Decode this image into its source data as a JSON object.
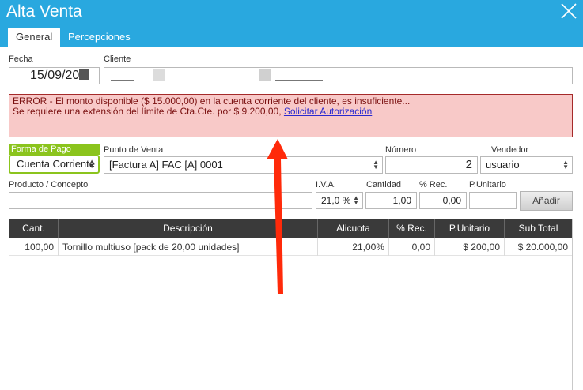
{
  "window": {
    "title": "Alta Venta"
  },
  "tabs": [
    {
      "label": "General",
      "active": true
    },
    {
      "label": "Percepciones",
      "active": false
    }
  ],
  "fecha": {
    "label": "Fecha",
    "value": "15/09/20"
  },
  "cliente": {
    "label": "Cliente"
  },
  "error": {
    "line1": "ERROR - El monto disponible ($ 15.000,00) en la cuenta corriente del cliente, es insuficiente...",
    "line2": "Se requiere una extensión del límite de Cta.Cte. por $ 9.200,00,",
    "link": "Solicitar Autorización"
  },
  "forma_pago": {
    "label": "Forma de Pago",
    "value": "Cuenta Corriente"
  },
  "punto_venta": {
    "label": "Punto de Venta",
    "value": "[Factura A] FAC [A] 0001"
  },
  "numero": {
    "label": "Número",
    "value": "2"
  },
  "vendedor": {
    "label": "Vendedor",
    "value": "usuario"
  },
  "producto": {
    "label": "Producto / Concepto",
    "value": ""
  },
  "iva": {
    "label": "I.V.A.",
    "value": "21,0 %"
  },
  "cantidad": {
    "label": "Cantidad",
    "value": "1,00"
  },
  "rec": {
    "label": "% Rec.",
    "value": "0,00"
  },
  "punitario": {
    "label": "P.Unitario",
    "value": ""
  },
  "add_button": "Añadir",
  "table": {
    "headers": [
      "Cant.",
      "Descripción",
      "Alicuota",
      "% Rec.",
      "P.Unitario",
      "Sub Total"
    ],
    "rows": [
      [
        "100,00",
        "Tornillo multiuso [pack de 20,00 unidades]",
        "21,00%",
        "0,00",
        "$ 200,00",
        "$ 20.000,00"
      ]
    ]
  },
  "colors": {
    "header": "#29a8df",
    "accent_green": "#8bc41d",
    "error_bg": "#f8c9c8",
    "arrow": "#ff2a0a"
  },
  "icons": [
    "close-icon",
    "spinner-icon",
    "annotation-arrow"
  ]
}
